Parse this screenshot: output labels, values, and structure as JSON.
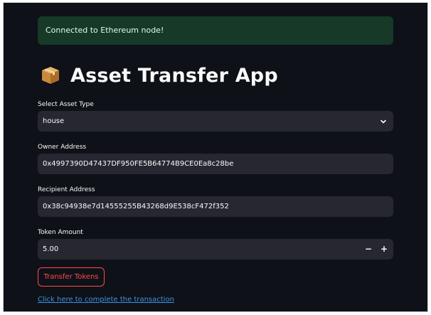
{
  "alert": {
    "text": "Connected to Ethereum node!"
  },
  "header": {
    "icon": "package-icon",
    "title": "Asset Transfer App"
  },
  "form": {
    "asset_type": {
      "label": "Select Asset Type",
      "value": "house",
      "icon": "chevron-down-icon"
    },
    "owner_address": {
      "label": "Owner Address",
      "value": "0x4997390D47437DF950FE5B64774B9CE0Ea8c28be"
    },
    "recipient_address": {
      "label": "Recipient Address",
      "value": "0x38c94938e7d14555255B43268d9E538cF472f352"
    },
    "token_amount": {
      "label": "Token Amount",
      "value": "5.00",
      "decrement": "−",
      "increment": "+"
    }
  },
  "actions": {
    "transfer_label": "Transfer Tokens",
    "complete_link": "Click here to complete the transaction"
  },
  "colors": {
    "background": "#0e1117",
    "success_bg": "#173928",
    "input_bg": "#262730",
    "accent_red": "#ff4b4b",
    "link_blue": "#3b94e6"
  }
}
